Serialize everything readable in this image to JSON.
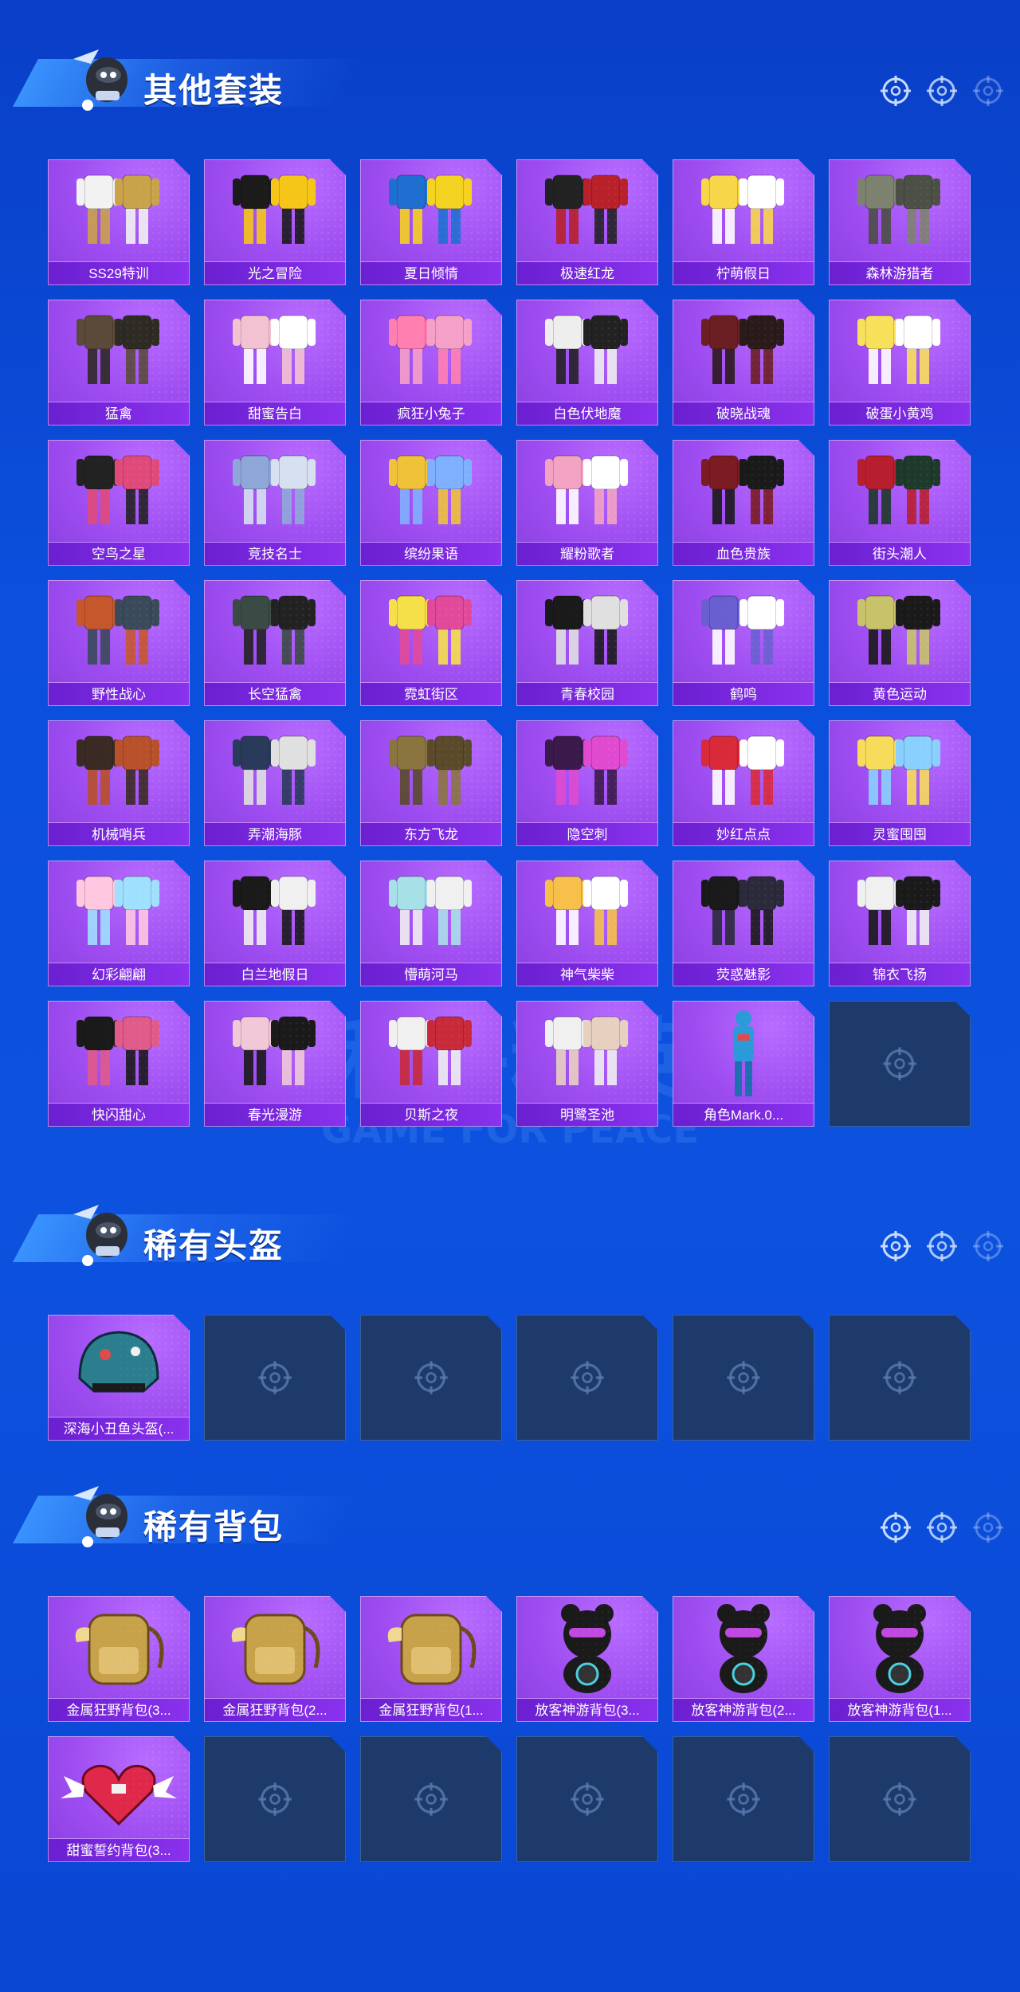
{
  "colors": {
    "background": "#0b4fdc",
    "card_purple": "#9d4cf0",
    "label_purple": "#7a28e0",
    "empty_slot": "#1e3a6a",
    "title_white": "#ffffff"
  },
  "watermark": {
    "line1": "和平精英",
    "line2": "GAME FOR PEACE"
  },
  "sections": [
    {
      "title": "其他套装",
      "items": [
        {
          "label": "SS29特训",
          "thumb": "outfit"
        },
        {
          "label": "光之冒险",
          "thumb": "outfit"
        },
        {
          "label": "夏日倾情",
          "thumb": "outfit"
        },
        {
          "label": "极速红龙",
          "thumb": "outfit"
        },
        {
          "label": "柠萌假日",
          "thumb": "outfit"
        },
        {
          "label": "森林游猎者",
          "thumb": "outfit"
        },
        {
          "label": "猛禽",
          "thumb": "outfit"
        },
        {
          "label": "甜蜜告白",
          "thumb": "outfit"
        },
        {
          "label": "疯狂小兔子",
          "thumb": "outfit"
        },
        {
          "label": "白色伏地魔",
          "thumb": "outfit"
        },
        {
          "label": "破晓战魂",
          "thumb": "outfit"
        },
        {
          "label": "破蛋小黄鸡",
          "thumb": "outfit"
        },
        {
          "label": "空鸟之星",
          "thumb": "outfit"
        },
        {
          "label": "竞技名士",
          "thumb": "outfit"
        },
        {
          "label": "缤纷果语",
          "thumb": "outfit"
        },
        {
          "label": "耀粉歌者",
          "thumb": "outfit"
        },
        {
          "label": "血色贵族",
          "thumb": "outfit"
        },
        {
          "label": "街头潮人",
          "thumb": "outfit"
        },
        {
          "label": "野性战心",
          "thumb": "outfit"
        },
        {
          "label": "长空猛禽",
          "thumb": "outfit"
        },
        {
          "label": "霓虹街区",
          "thumb": "outfit"
        },
        {
          "label": "青春校园",
          "thumb": "outfit"
        },
        {
          "label": "鹤鸣",
          "thumb": "outfit"
        },
        {
          "label": "黄色运动",
          "thumb": "outfit"
        },
        {
          "label": "机械哨兵",
          "thumb": "outfit"
        },
        {
          "label": "弄潮海豚",
          "thumb": "outfit"
        },
        {
          "label": "东方飞龙",
          "thumb": "outfit"
        },
        {
          "label": "隐空刺",
          "thumb": "outfit"
        },
        {
          "label": "妙红点点",
          "thumb": "outfit"
        },
        {
          "label": "灵蜜囤囤",
          "thumb": "outfit"
        },
        {
          "label": "幻彩翩翩",
          "thumb": "outfit"
        },
        {
          "label": "白兰地假日",
          "thumb": "outfit"
        },
        {
          "label": "懵萌河马",
          "thumb": "outfit"
        },
        {
          "label": "神气柴柴",
          "thumb": "outfit"
        },
        {
          "label": "荧惑魅影",
          "thumb": "outfit"
        },
        {
          "label": "锦衣飞扬",
          "thumb": "outfit"
        },
        {
          "label": "快闪甜心",
          "thumb": "outfit"
        },
        {
          "label": "春光漫游",
          "thumb": "outfit"
        },
        {
          "label": "贝斯之夜",
          "thumb": "outfit"
        },
        {
          "label": "明鹭圣池",
          "thumb": "outfit"
        },
        {
          "label": "角色Mark.0...",
          "thumb": "figure"
        }
      ],
      "empty_slots": 1
    },
    {
      "title": "稀有头盔",
      "items": [
        {
          "label": "深海小丑鱼头盔(...",
          "thumb": "helmet"
        }
      ],
      "empty_slots": 5
    },
    {
      "title": "稀有背包",
      "items": [
        {
          "label": "金属狂野背包(3...",
          "thumb": "backpack"
        },
        {
          "label": "金属狂野背包(2...",
          "thumb": "backpack"
        },
        {
          "label": "金属狂野背包(1...",
          "thumb": "backpack"
        },
        {
          "label": "放客神游背包(3...",
          "thumb": "bear-backpack"
        },
        {
          "label": "放客神游背包(2...",
          "thumb": "bear-backpack"
        },
        {
          "label": "放客神游背包(1...",
          "thumb": "bear-backpack"
        },
        {
          "label": "甜蜜誓约背包(3...",
          "thumb": "heart-backpack"
        }
      ],
      "empty_slots": 5
    }
  ]
}
